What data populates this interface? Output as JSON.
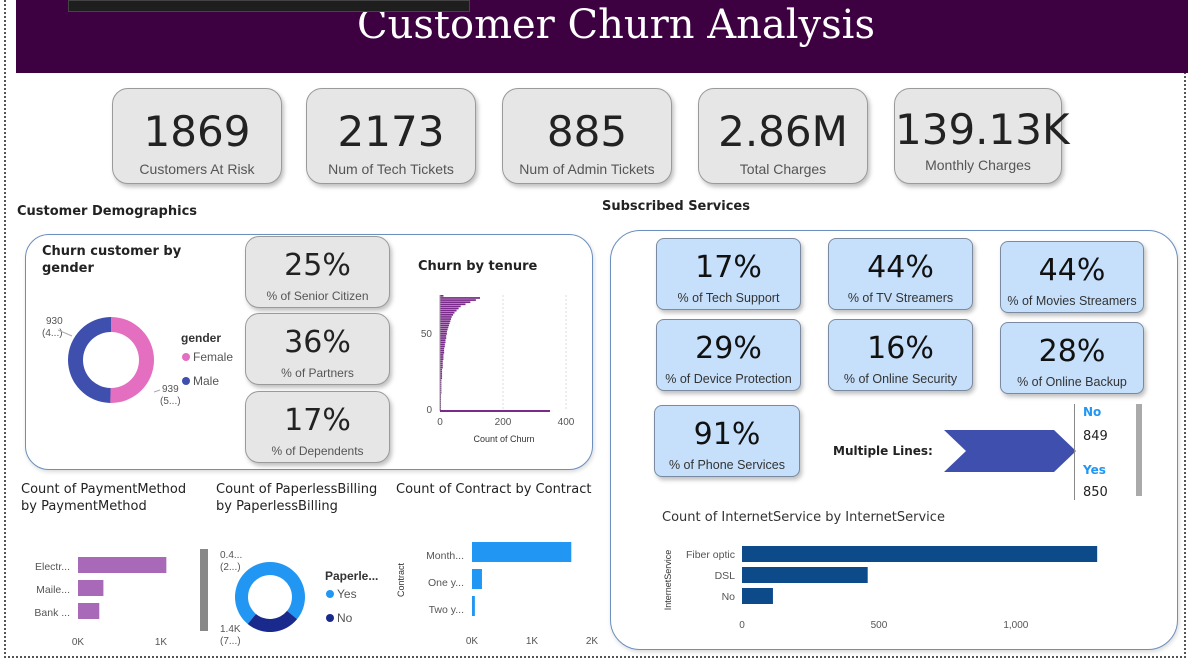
{
  "header": {
    "title": "Customer Churn Analysis"
  },
  "kpis": [
    {
      "value": "1869",
      "label": "Customers At Risk"
    },
    {
      "value": "2173",
      "label": "Num of Tech Tickets"
    },
    {
      "value": "885",
      "label": "Num of Admin Tickets"
    },
    {
      "value": "2.86M",
      "label": "Total Charges"
    },
    {
      "value": "139.13K",
      "label": "Monthly Charges"
    }
  ],
  "demographics": {
    "section_title": "Customer Demographics",
    "gender_chart": {
      "title": "Churn customer by gender",
      "legend_title": "gender",
      "female_label": "Female",
      "male_label": "Male",
      "label_male_value": "930",
      "label_male_pct": "(4...)",
      "label_female_value": "939",
      "label_female_pct": "(5...)"
    },
    "cards": [
      {
        "value": "25%",
        "label": "% of Senior Citizen"
      },
      {
        "value": "36%",
        "label": "% of Partners"
      },
      {
        "value": "17%",
        "label": "% of Dependents"
      }
    ],
    "tenure_chart": {
      "title": "Churn by tenure",
      "xlabel": "Count of Churn"
    }
  },
  "services": {
    "section_title": "Subscribed Services",
    "cards": [
      {
        "value": "17%",
        "label": "% of Tech Support"
      },
      {
        "value": "44%",
        "label": "% of TV Streamers"
      },
      {
        "value": "44%",
        "label": "% of Movies Streamers"
      },
      {
        "value": "29%",
        "label": "% of Device Protection"
      },
      {
        "value": "16%",
        "label": "% of Online Security"
      },
      {
        "value": "28%",
        "label": "% of Online Backup"
      },
      {
        "value": "91%",
        "label": "% of Phone Services"
      }
    ],
    "multiple_lines": {
      "label": "Multiple Lines:",
      "no_label": "No",
      "no_value": "849",
      "yes_label": "Yes",
      "yes_value": "850"
    },
    "internet_chart": {
      "title": "Count of InternetService by InternetService",
      "ylabel": "InternetService"
    }
  },
  "bottom": {
    "payment_title": "Count of PaymentMethod by PaymentMethod",
    "billing": {
      "title": "Count of PaperlessBilling by PaperlessBilling",
      "legend_title": "Paperle...",
      "yes_label": "Yes",
      "no_label": "No",
      "top_value": "0.4...",
      "top_pct": "(2...)",
      "bottom_value": "1.4K",
      "bottom_pct": "(7...)"
    },
    "contract_title": "Count of Contract by Contract",
    "contract_ylabel": "Contract"
  },
  "colors": {
    "banner": "#3d0040",
    "female": "#e46ec0",
    "male": "#3f4fae",
    "tenure_bar": "#7a2a8a",
    "payment_bar": "#a86ab8",
    "billing_yes": "#2196f3",
    "billing_no": "#1a2a8c",
    "contract_bar": "#2196f3",
    "internet_bar": "#0d4a8a",
    "arrow": "#3f4fae",
    "yes_no_label": "#2196f3"
  },
  "chart_data": [
    {
      "type": "pie",
      "title": "Churn customer by gender",
      "categories": [
        "Female",
        "Male"
      ],
      "values": [
        939,
        930
      ]
    },
    {
      "type": "bar",
      "title": "Churn by tenure",
      "xlabel": "Count of Churn",
      "xlim": [
        0,
        400
      ],
      "x_ticks": [
        0,
        200,
        400
      ],
      "y_ticks": [
        0,
        50
      ],
      "values": [
        5,
        58,
        52,
        44,
        37,
        30,
        27,
        24,
        21,
        19,
        17,
        16,
        15,
        14,
        13,
        12,
        11,
        10,
        10,
        9,
        9,
        8,
        8,
        7,
        7,
        6,
        6,
        6,
        5,
        5,
        5,
        4,
        4,
        4,
        4,
        3,
        3,
        3,
        3,
        3,
        2,
        2,
        2,
        2,
        2,
        2,
        2,
        1,
        1,
        1,
        1,
        1,
        1,
        1,
        1
      ]
    },
    {
      "type": "bar",
      "title": "Count of PaymentMethod by PaymentMethod",
      "categories": [
        "Electr...",
        "Maile...",
        "Bank ..."
      ],
      "values": [
        1071,
        308,
        258
      ],
      "x_ticks": [
        "0K",
        "1K"
      ],
      "xlim": [
        0,
        1200
      ]
    },
    {
      "type": "pie",
      "title": "Count of PaperlessBilling by PaperlessBilling",
      "categories": [
        "Yes",
        "No"
      ],
      "values": [
        1400,
        469
      ]
    },
    {
      "type": "bar",
      "title": "Count of Contract by Contract",
      "categories": [
        "Month...",
        "One y...",
        "Two y..."
      ],
      "values": [
        1655,
        166,
        48
      ],
      "x_ticks": [
        "0K",
        "1K",
        "2K"
      ],
      "xlim": [
        0,
        2000
      ]
    },
    {
      "type": "bar",
      "title": "Count of InternetService by InternetService",
      "categories": [
        "Fiber optic",
        "DSL",
        "No"
      ],
      "values": [
        1297,
        459,
        113
      ],
      "x_ticks": [
        "0",
        "500",
        "1,000"
      ],
      "xlim": [
        0,
        1300
      ]
    }
  ]
}
